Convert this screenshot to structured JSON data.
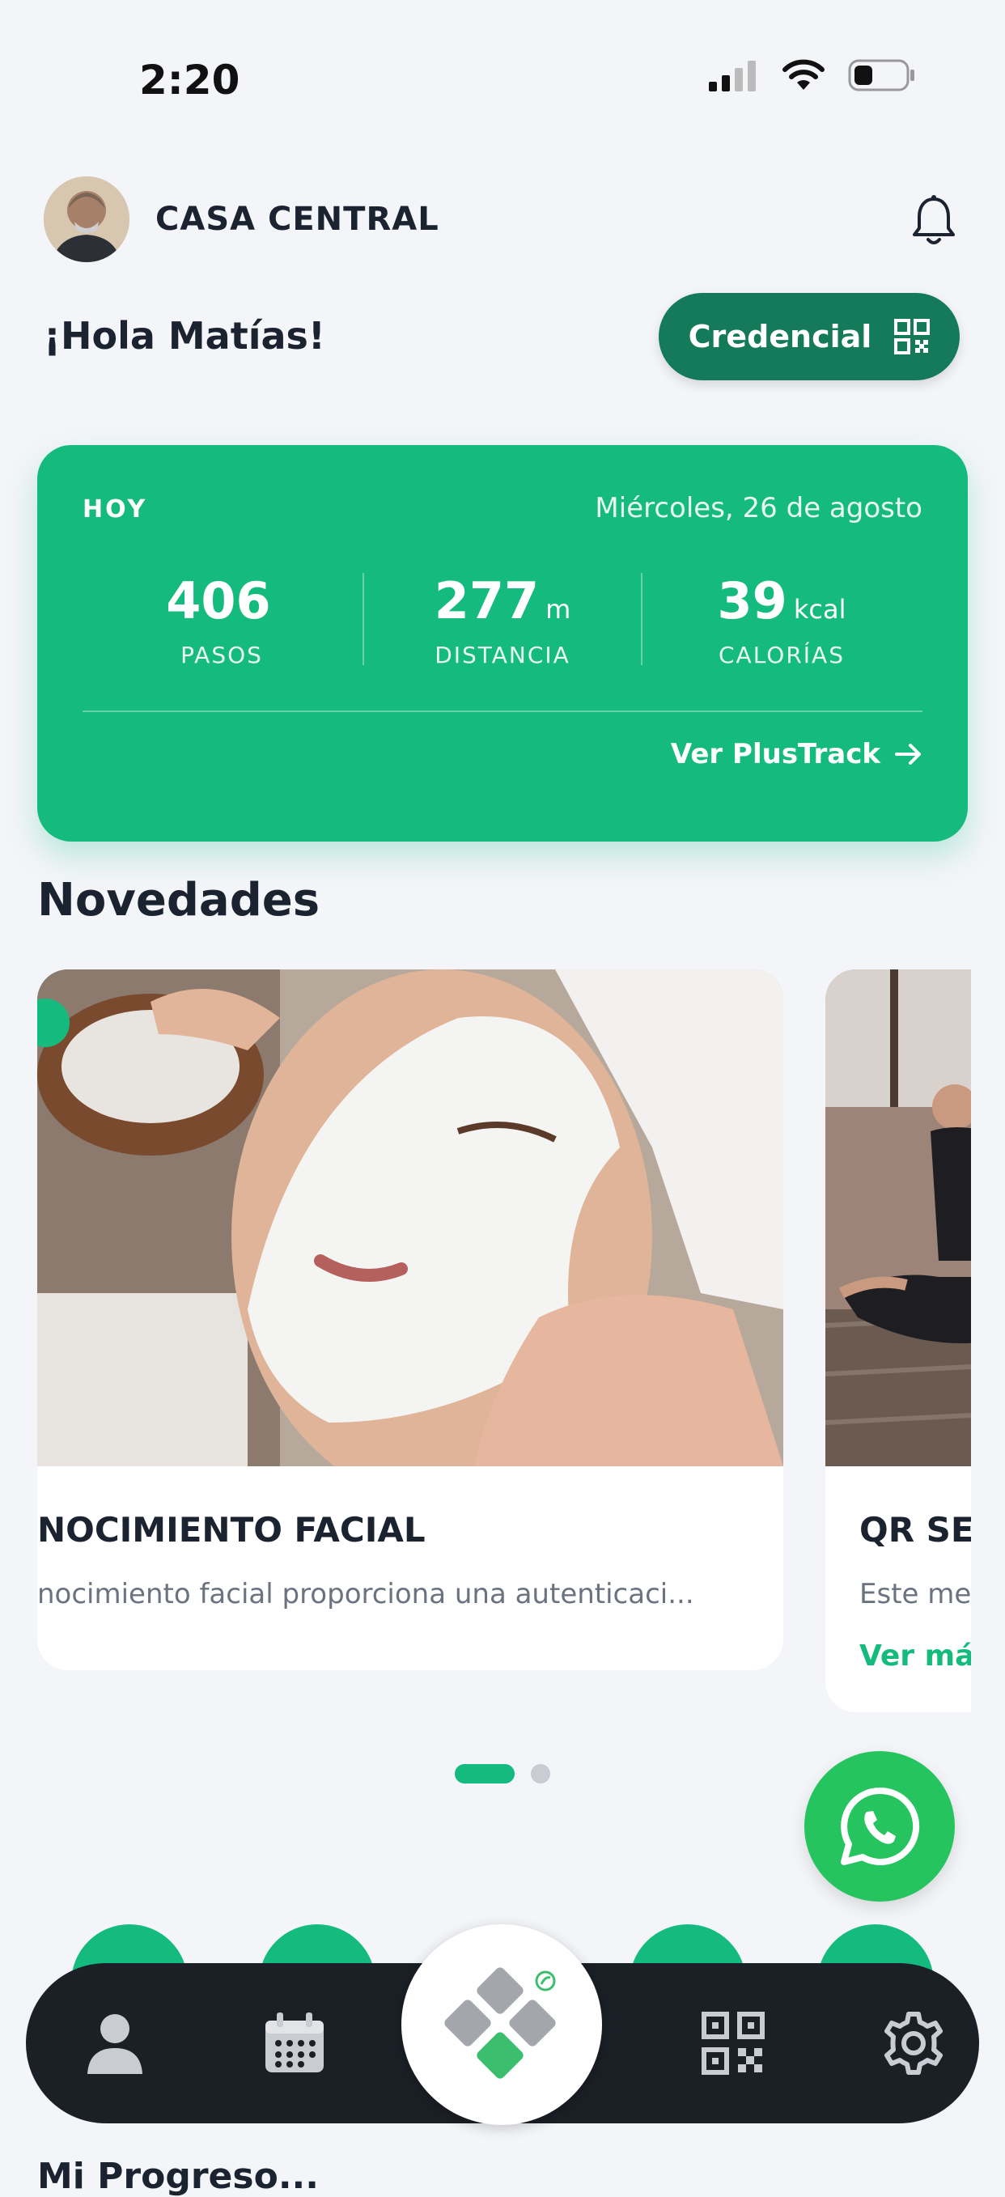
{
  "status_bar": {
    "time": "2:20"
  },
  "header": {
    "branch": "CASA CENTRAL",
    "greeting": "¡Hola Matías!",
    "credential_label": "Credencial"
  },
  "today_card": {
    "label": "HOY",
    "date": "Miércoles, 26 de agosto",
    "stats": [
      {
        "value": "406",
        "unit": "",
        "label": "PASOS"
      },
      {
        "value": "277",
        "unit": "m",
        "label": "DISTANCIA"
      },
      {
        "value": "39",
        "unit": "kcal",
        "label": "CALORÍAS"
      }
    ],
    "link_label": "Ver PlusTrack"
  },
  "news": {
    "section_title": "Novedades",
    "items": [
      {
        "title": "NOCIMIENTO FACIAL",
        "description": "nocimiento facial proporciona una autenticaci..."
      },
      {
        "title": "QR SE",
        "description": "Este me",
        "link": "Ver má"
      }
    ],
    "pager": {
      "pages": 2,
      "active": 1
    }
  },
  "colors": {
    "accent": "#15bb7e",
    "credential_button": "#157a5a",
    "whatsapp": "#25c45e",
    "nav_background": "#1b1f26"
  },
  "nav": {
    "items": [
      {
        "icon": "user-icon"
      },
      {
        "icon": "calendar-icon"
      },
      {
        "icon": "app-logo-icon"
      },
      {
        "icon": "qr-code-icon"
      },
      {
        "icon": "gear-icon"
      }
    ]
  },
  "bottom_partial": {
    "text": "Mi Progreso..."
  }
}
